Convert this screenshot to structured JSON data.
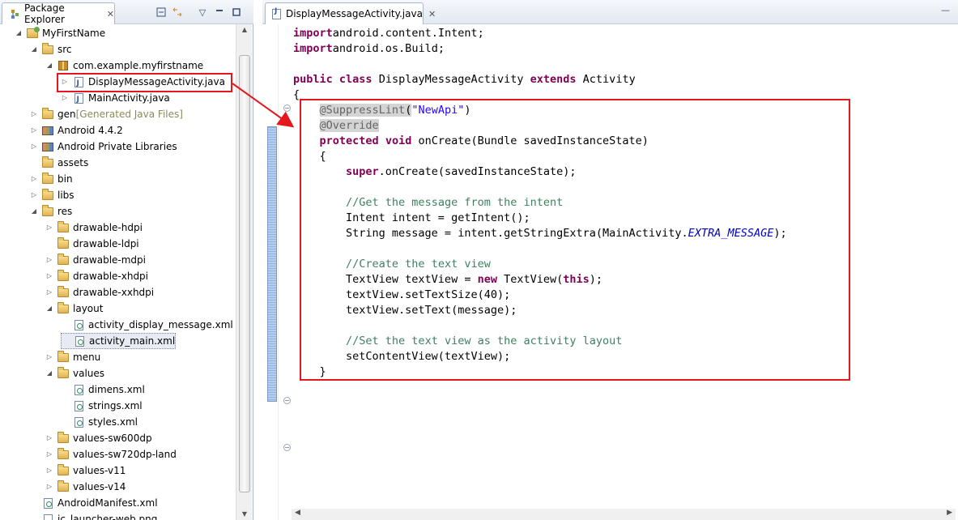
{
  "package_explorer": {
    "title": "Package Explorer",
    "toolbar_icons": [
      "collapse-all-icon",
      "link-with-editor-icon",
      "view-menu-icon",
      "minimize-icon",
      "maximize-icon"
    ],
    "tree": [
      {
        "label": "MyFirstName",
        "expanded": true,
        "icon": "project-icon"
      },
      {
        "label": "src",
        "expanded": true,
        "icon": "folder-icon"
      },
      {
        "label": "com.example.myfirstname",
        "expanded": true,
        "icon": "package-icon"
      },
      {
        "label": "DisplayMessageActivity.java",
        "expanded": false,
        "icon": "java-file-icon",
        "highlighted": true
      },
      {
        "label": "MainActivity.java",
        "expanded": false,
        "icon": "java-file-icon"
      },
      {
        "label": "gen",
        "decoration": "[Generated Java Files]",
        "expanded": false,
        "icon": "folder-icon"
      },
      {
        "label": "Android 4.4.2",
        "expanded": false,
        "icon": "library-icon"
      },
      {
        "label": "Android Private Libraries",
        "expanded": false,
        "icon": "library-icon"
      },
      {
        "label": "assets",
        "icon": "folder-icon"
      },
      {
        "label": "bin",
        "expanded": false,
        "icon": "folder-icon"
      },
      {
        "label": "libs",
        "expanded": false,
        "icon": "folder-icon"
      },
      {
        "label": "res",
        "expanded": true,
        "icon": "folder-icon"
      },
      {
        "label": "drawable-hdpi",
        "expanded": false,
        "icon": "folder-icon"
      },
      {
        "label": "drawable-ldpi",
        "icon": "folder-icon"
      },
      {
        "label": "drawable-mdpi",
        "expanded": false,
        "icon": "folder-icon"
      },
      {
        "label": "drawable-xhdpi",
        "expanded": false,
        "icon": "folder-icon"
      },
      {
        "label": "drawable-xxhdpi",
        "expanded": false,
        "icon": "folder-icon"
      },
      {
        "label": "layout",
        "expanded": true,
        "icon": "folder-icon"
      },
      {
        "label": "activity_display_message.xml",
        "icon": "xml-file-icon"
      },
      {
        "label": "activity_main.xml",
        "icon": "xml-file-icon",
        "selected": true
      },
      {
        "label": "menu",
        "expanded": false,
        "icon": "folder-icon"
      },
      {
        "label": "values",
        "expanded": true,
        "icon": "folder-icon"
      },
      {
        "label": "dimens.xml",
        "icon": "xml-file-icon"
      },
      {
        "label": "strings.xml",
        "icon": "xml-file-icon"
      },
      {
        "label": "styles.xml",
        "icon": "xml-file-icon"
      },
      {
        "label": "values-sw600dp",
        "expanded": false,
        "icon": "folder-icon"
      },
      {
        "label": "values-sw720dp-land",
        "expanded": false,
        "icon": "folder-icon"
      },
      {
        "label": "values-v11",
        "expanded": false,
        "icon": "folder-icon"
      },
      {
        "label": "values-v14",
        "expanded": false,
        "icon": "folder-icon"
      },
      {
        "label": "AndroidManifest.xml",
        "icon": "xml-file-icon"
      },
      {
        "label": "ic_launcher-web.png",
        "icon": "image-file-icon"
      }
    ]
  },
  "editor": {
    "tab_title": "DisplayMessageActivity.java",
    "code_lines": [
      [
        [
          "kw",
          "import"
        ],
        [
          "",
          "android.content.Intent;"
        ]
      ],
      [
        [
          "kw",
          "import"
        ],
        [
          "",
          "android.os.Build;"
        ]
      ],
      [],
      [
        [
          "kw",
          "public"
        ],
        [
          "",
          ""
        ],
        [
          "kw",
          "class"
        ],
        [
          "",
          " DisplayMessageActivity "
        ],
        [
          "kw",
          "extends"
        ],
        [
          "",
          " Activity"
        ]
      ],
      [
        [
          "",
          "{"
        ]
      ],
      [
        [
          "",
          "    "
        ],
        [
          "an hl",
          "@SuppressLint"
        ],
        [
          "hl",
          "("
        ],
        [
          "st",
          "\"NewApi\""
        ],
        [
          "",
          ")"
        ]
      ],
      [
        [
          "",
          "    "
        ],
        [
          "an hl",
          "@Override"
        ]
      ],
      [
        [
          "",
          "    "
        ],
        [
          "kw",
          "protected"
        ],
        [
          "",
          ""
        ],
        [
          "kw",
          "void"
        ],
        [
          "",
          " onCreate(Bundle savedInstanceState)"
        ]
      ],
      [
        [
          "",
          "    {"
        ]
      ],
      [
        [
          "",
          "        "
        ],
        [
          "kw",
          "super"
        ],
        [
          "",
          ".onCreate(savedInstanceState);"
        ]
      ],
      [],
      [
        [
          "",
          "        "
        ],
        [
          "cm",
          "//Get the message from the intent"
        ]
      ],
      [
        [
          "",
          "        Intent intent = getIntent();"
        ]
      ],
      [
        [
          "",
          "        String message = intent.getStringExtra(MainActivity."
        ],
        [
          "it",
          "EXTRA_MESSAGE"
        ],
        [
          "",
          ");"
        ]
      ],
      [],
      [
        [
          "",
          "        "
        ],
        [
          "cm",
          "//Create the text view"
        ]
      ],
      [
        [
          "",
          "        TextView textView = "
        ],
        [
          "kw",
          "new"
        ],
        [
          "",
          " TextView("
        ],
        [
          "kw",
          "this"
        ],
        [
          "",
          ");"
        ]
      ],
      [
        [
          "",
          "        textView.setTextSize(40);"
        ]
      ],
      [
        [
          "",
          "        textView.setText(message);"
        ]
      ],
      [],
      [
        [
          "",
          "        "
        ],
        [
          "cm",
          "//Set the text view as the activity layout"
        ]
      ],
      [
        [
          "",
          "        setContentView(textView);"
        ]
      ],
      [
        [
          "",
          "    }"
        ]
      ]
    ]
  },
  "colors": {
    "highlight_red": "#e3171f",
    "keyword": "#7f0055",
    "string": "#2a00ff",
    "comment": "#3f7f5f",
    "annotation": "#646464",
    "static_field": "#0000c0"
  }
}
